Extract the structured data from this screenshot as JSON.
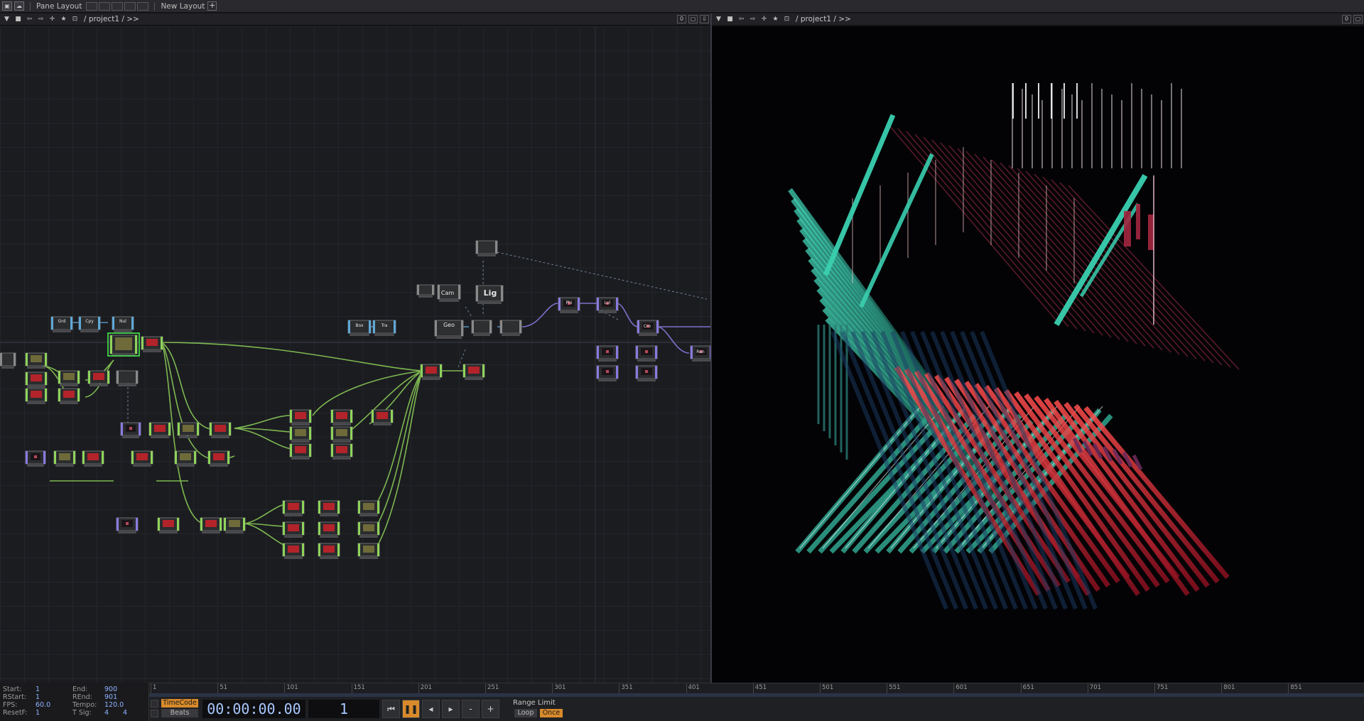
{
  "menubar": {
    "pane_layout_label": "Pane Layout",
    "new_layout_label": "New Layout",
    "plus_label": "+"
  },
  "left_pane": {
    "path": "/ project1 / >>",
    "right_counter": "0"
  },
  "right_pane": {
    "path": "/ project1 / >>",
    "right_counter": "0"
  },
  "network": {
    "nodes_labeled": {
      "cam": "Cam",
      "lig": "Lig",
      "geo": "Geo",
      "grd": "Grd",
      "cpy": "Cpy",
      "nul": "Nul",
      "box": "Box",
      "tra": "Tra",
      "phi": "Phi",
      "lvl": "Lvl",
      "cro": "Cro",
      "ren": "Ren"
    }
  },
  "timeline": {
    "ticks": [
      "1",
      "51",
      "101",
      "151",
      "201",
      "251",
      "301",
      "351",
      "401",
      "451",
      "501",
      "551",
      "601",
      "651",
      "701",
      "751",
      "801",
      "851"
    ]
  },
  "stats": {
    "start_label": "Start:",
    "start_value": "1",
    "rstart_label": "RStart:",
    "rstart_value": "1",
    "fps_label": "FPS:",
    "fps_value": "60.0",
    "resetf_label": "ResetF:",
    "resetf_value": "1",
    "end_label": "End:",
    "end_value": "900",
    "rend_label": "REnd:",
    "rend_value": "901",
    "tempo_label": "Tempo:",
    "tempo_value": "120.0",
    "tsig_label": "T Sig:",
    "tsig_num": "4",
    "tsig_den": "4"
  },
  "transport": {
    "timecode_mode": "TimeCode",
    "beats_mode": "Beats",
    "timecode": "00:00:00.00",
    "frame": "1",
    "minus": "-",
    "plus": "+",
    "range_limit_label": "Range Limit",
    "loop_label": "Loop",
    "once_label": "Once"
  },
  "colors": {
    "accent_orange": "#d88a2b",
    "wire_green": "#8fd45a",
    "wire_purple": "#8a7ae0",
    "viz_red": "#e8343a",
    "viz_teal": "#2fb59a"
  }
}
